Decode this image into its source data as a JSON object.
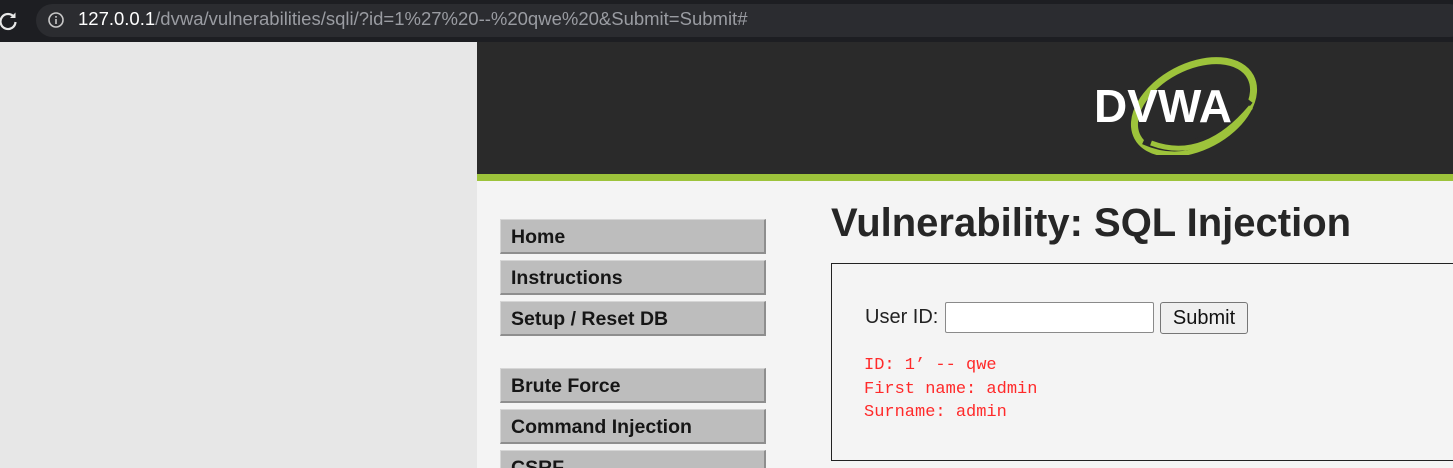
{
  "browser": {
    "url_host": "127.0.0.1",
    "url_path": "/dvwa/vulnerabilities/sqli/?id=1%27%20--%20qwe%20&Submit=Submit#"
  },
  "header": {
    "logo_text": "DVWA"
  },
  "menu": {
    "items": [
      {
        "label": "Home"
      },
      {
        "label": "Instructions"
      },
      {
        "label": "Setup / Reset DB"
      },
      {
        "label": "Brute Force"
      },
      {
        "label": "Command Injection"
      },
      {
        "label": "CSRF"
      }
    ]
  },
  "main": {
    "title": "Vulnerability: SQL Injection",
    "form": {
      "user_id_label": "User ID:",
      "user_id_value": "",
      "submit_label": "Submit"
    },
    "result": {
      "id_line": "ID: 1’ -- qwe",
      "first_name_line": "First name: admin",
      "surname_line": "Surname: admin"
    }
  },
  "colors": {
    "accent_green": "#9dc33b",
    "header_bg": "#2a2a2a",
    "result_red": "#ff2a2a"
  }
}
